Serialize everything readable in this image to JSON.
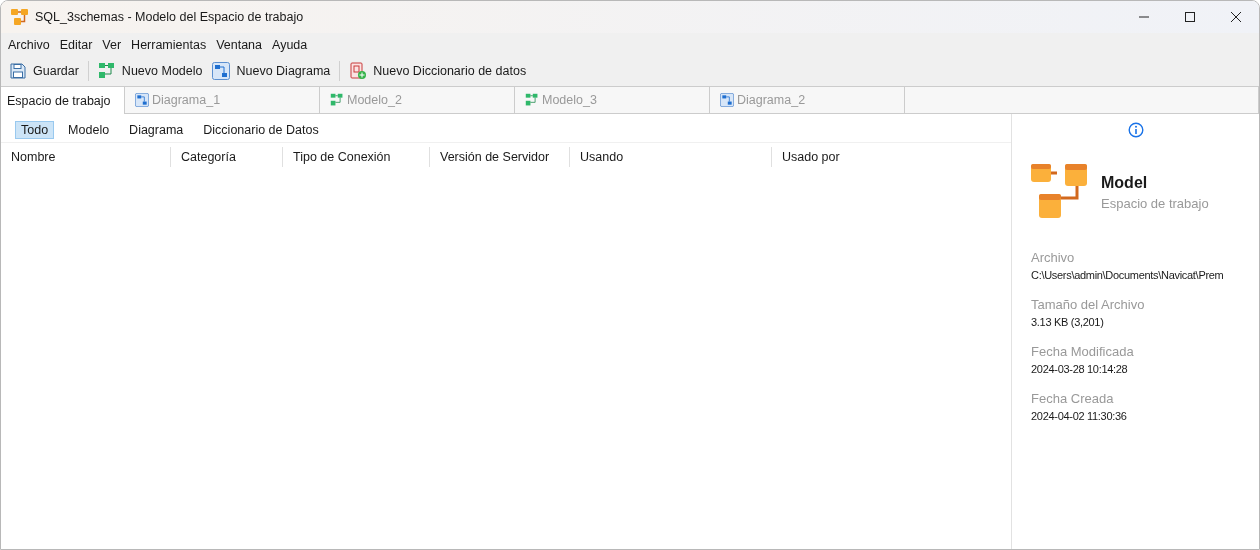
{
  "window": {
    "title": "SQL_3schemas - Modelo del Espacio de trabajo"
  },
  "menu": [
    "Archivo",
    "Editar",
    "Ver",
    "Herramientas",
    "Ventana",
    "Ayuda"
  ],
  "toolbar": [
    {
      "kind": "save",
      "label": "Guardar"
    },
    {
      "kind": "model",
      "label": "Nuevo Modelo"
    },
    {
      "kind": "diagram",
      "label": "Nuevo Diagrama"
    },
    {
      "kind": "dictionary",
      "label": "Nuevo Diccionario de datos"
    }
  ],
  "tabs": [
    {
      "kind": "workspace",
      "label": "Espacio de trabajo",
      "selected": true
    },
    {
      "kind": "diagram",
      "label": "Diagrama_1",
      "selected": false
    },
    {
      "kind": "model",
      "label": "Modelo_2",
      "selected": false
    },
    {
      "kind": "model",
      "label": "Modelo_3",
      "selected": false
    },
    {
      "kind": "diagram",
      "label": "Diagrama_2",
      "selected": false
    }
  ],
  "filters": [
    {
      "label": "Todo",
      "selected": true
    },
    {
      "label": "Modelo",
      "selected": false
    },
    {
      "label": "Diagrama",
      "selected": false
    },
    {
      "label": "Diccionario de Datos",
      "selected": false
    }
  ],
  "table": {
    "columns": [
      "Nombre",
      "Categoría",
      "Tipo de Conexión",
      "Versión de Servidor",
      "Usando",
      "Usado por"
    ]
  },
  "info_panel": {
    "name": "Model",
    "type": "Espacio de trabajo",
    "fields": [
      {
        "label": "Archivo",
        "value": "C:\\Users\\admin\\Documents\\Navicat\\Prem"
      },
      {
        "label": "Tamaño del Archivo",
        "value": "3.13 KB (3,201)"
      },
      {
        "label": "Fecha Modificada",
        "value": "2024-03-28 10:14:28"
      },
      {
        "label": "Fecha Creada",
        "value": "2024-04-02 11:30:36"
      }
    ]
  }
}
